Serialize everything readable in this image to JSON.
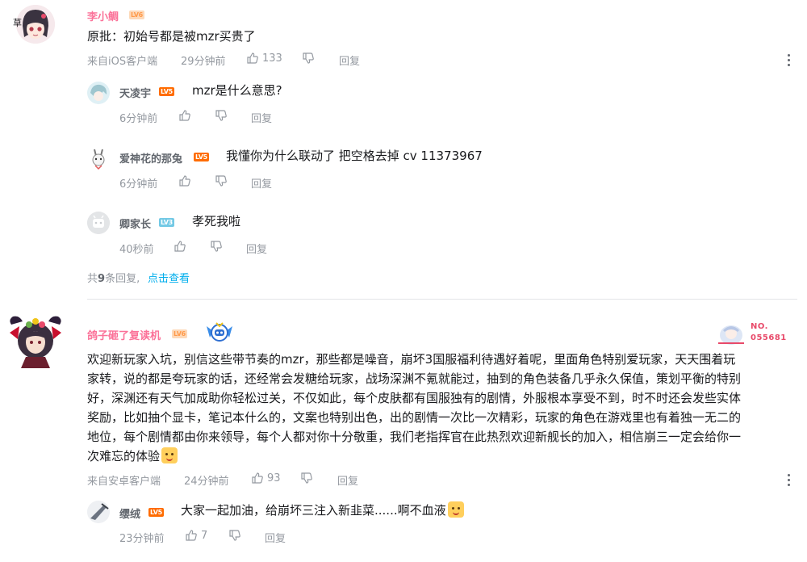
{
  "comments": [
    {
      "user": "李小鲷",
      "level": "LV6",
      "avatar_tag": "草",
      "content": "原批：初始号都是被mzr买贵了",
      "source": "来自iOS客户端",
      "time": "29分钟前",
      "likes": "133",
      "reply_label": "回复",
      "replies": [
        {
          "user": "天凌宇",
          "level": "LV5",
          "content": "mzr是什么意思?",
          "time": "6分钟前",
          "likes": "",
          "reply_label": "回复"
        },
        {
          "user": "爱神花的那兔",
          "level": "LV5",
          "content": "我懂你为什么联动了 把空格去掉 cv  11373967",
          "time": "6分钟前",
          "likes": "",
          "reply_label": "回复"
        },
        {
          "user": "卿家长",
          "level": "LV3",
          "content": "孝死我啦",
          "time": "40秒前",
          "likes": "",
          "reply_label": "回复"
        }
      ],
      "reply_summary_prefix": "共",
      "reply_summary_count": "9",
      "reply_summary_suffix": "条回复,",
      "reply_summary_link": "点击查看"
    },
    {
      "user": "鸽子砸了复读机",
      "level": "LV6",
      "badge_no_label": "NO.",
      "badge_no_value": "055681",
      "content_lines": [
        "欢迎新玩家入坑，别信这些带节奏的mzr，那些都是噪音，崩坏3国服福利待遇好着呢，里面角色特别爱玩家，天天围着玩",
        "家转，说的都是夸玩家的话，还经常会发糖给玩家，战场深渊不氪就能过，抽到的角色装备几乎永久保值，策划平衡的特别",
        "好，深渊还有天气加成助你轻松过关，不仅如此，每个皮肤都有国服独有的剧情，外服根本享受不到，时不时还会发些实体",
        "奖励，比如抽个显卡，笔记本什么的，文案也特别出色，出的剧情一次比一次精彩，玩家的角色在游戏里也有着独一无二的",
        "地位，每个剧情都由你来领导，每个人都对你十分敬重，我们老指挥官在此热烈欢迎新舰长的加入，相信崩三一定会给你一",
        "次难忘的体验"
      ],
      "emoji_name": "doge-emoji",
      "source": "来自安卓客户端",
      "time": "24分钟前",
      "likes": "93",
      "reply_label": "回复",
      "replies": [
        {
          "user": "缨绒",
          "level": "LV5",
          "content": "大家一起加油，给崩坏三注入新韭菜......啊不血液",
          "time": "23分钟前",
          "likes": "7",
          "reply_label": "回复"
        }
      ]
    }
  ],
  "colors": {
    "accent_pink": "#fb7299",
    "link_blue": "#00aeec",
    "meta_gray": "#9499a0"
  },
  "icons": [
    "thumbs-up-icon",
    "thumbs-down-icon",
    "more-icon"
  ]
}
